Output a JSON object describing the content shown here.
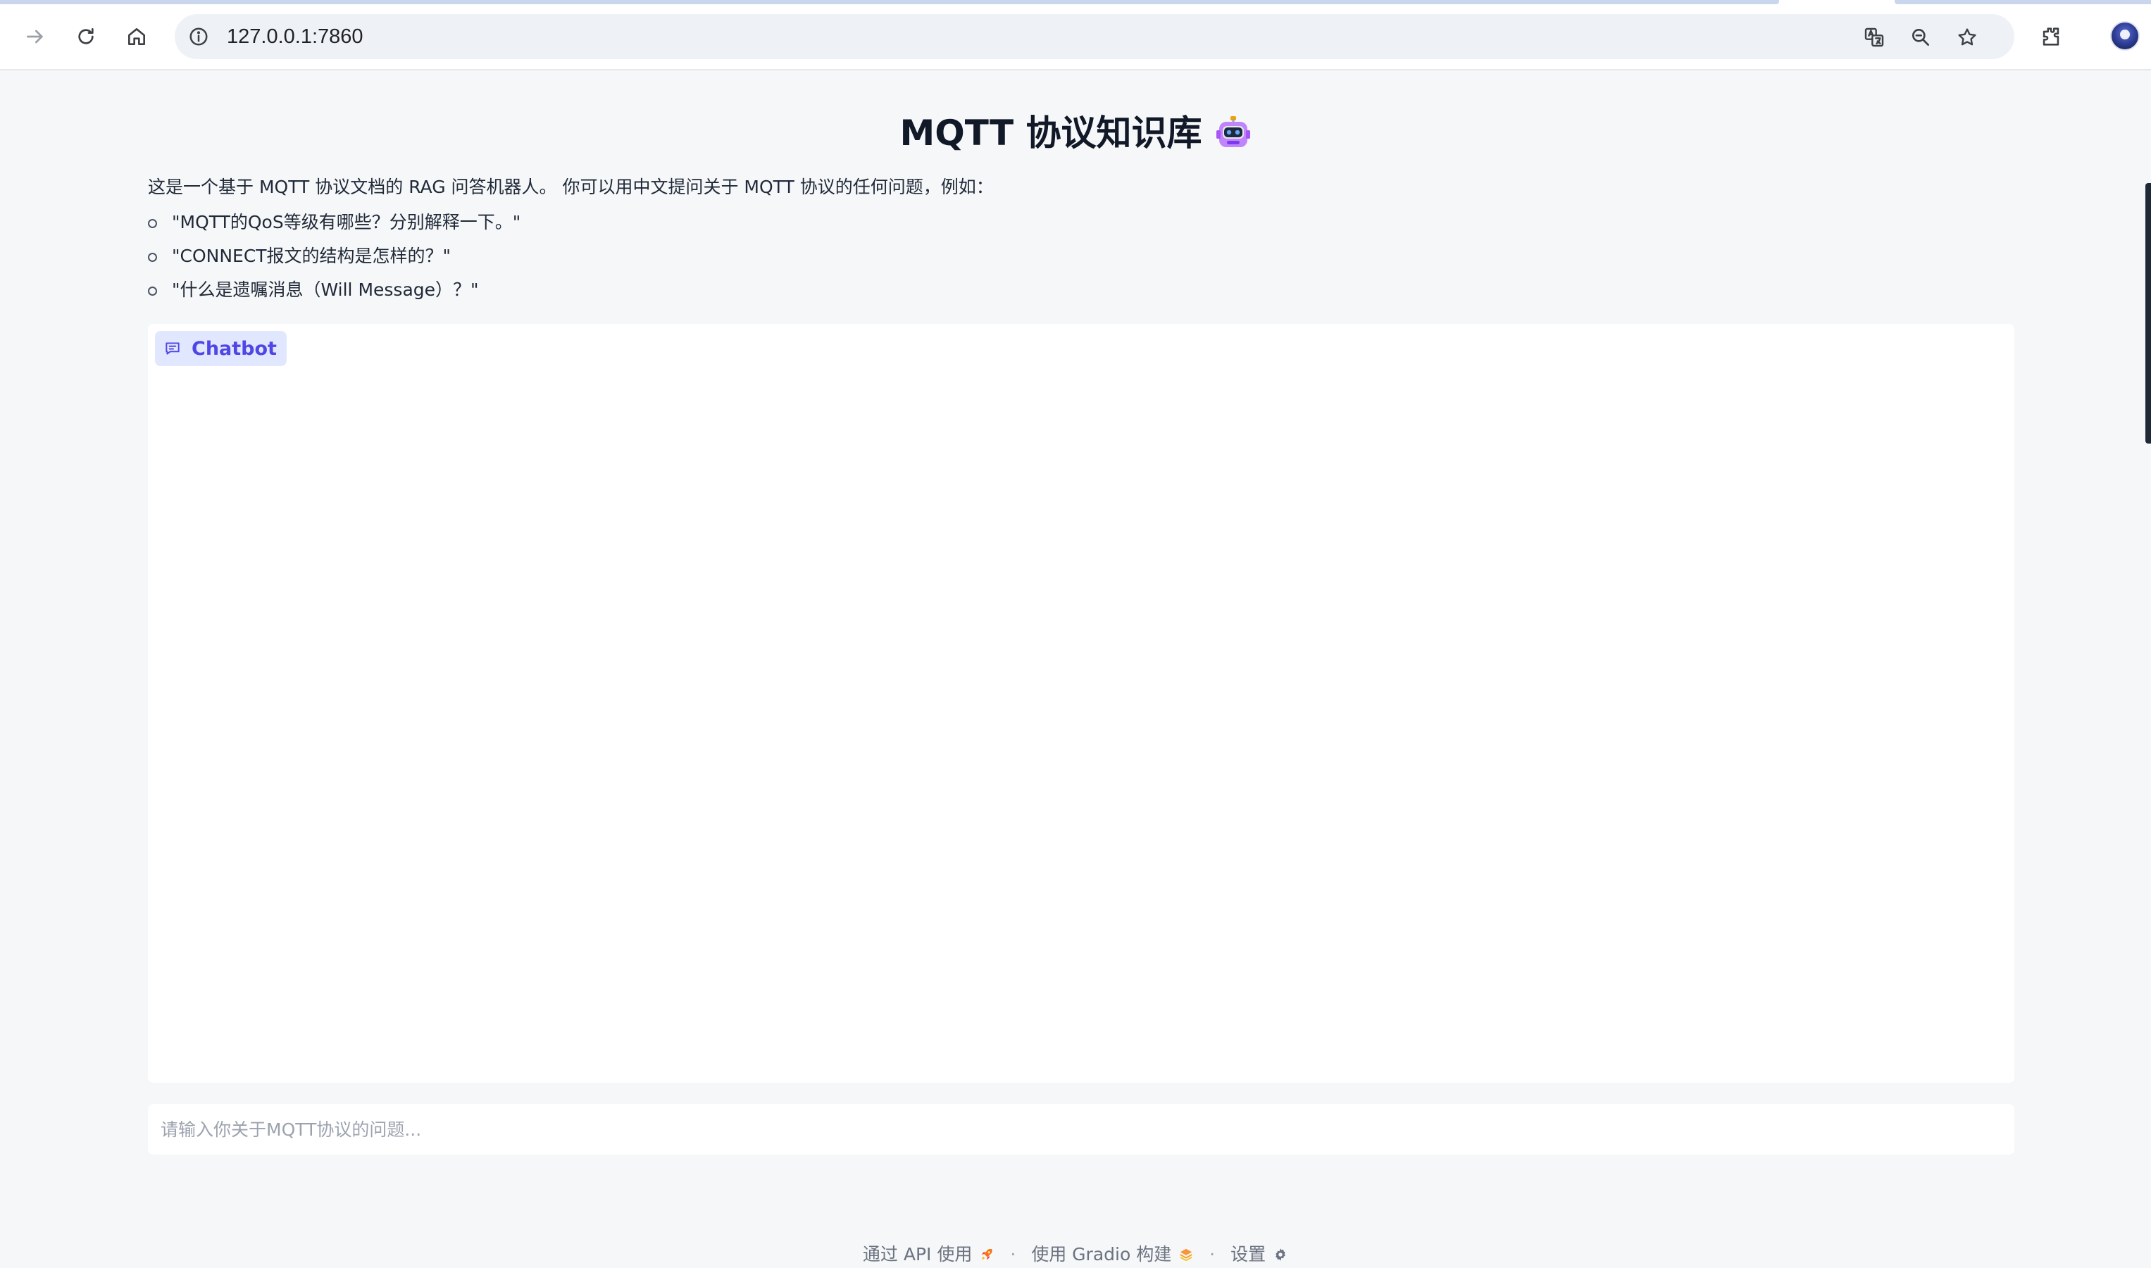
{
  "browser": {
    "url": "127.0.0.1:7860"
  },
  "page": {
    "title": "MQTT 协议知识库",
    "title_emoji": "robot-face-icon",
    "description": "这是一个基于 MQTT 协议文档的 RAG 问答机器人。 你可以用中文提问关于 MQTT 协议的任何问题，例如：",
    "examples": [
      "\"MQTT的QoS等级有哪些？分别解释一下。\"",
      "\"CONNECT报文的结构是怎样的？\"",
      "\"什么是遗嘱消息（Will Message）？\""
    ]
  },
  "chatbot": {
    "label": "Chatbot"
  },
  "input": {
    "placeholder": "请输入你关于MQTT协议的问题..."
  },
  "footer": {
    "api_label": "通过 API 使用",
    "gradio_label": "使用 Gradio 构建",
    "settings_label": "设置",
    "separator": "·"
  },
  "colors": {
    "accent": "#4f46e5",
    "label_bg": "#e0e7ff",
    "page_bg": "#f6f7f9"
  }
}
